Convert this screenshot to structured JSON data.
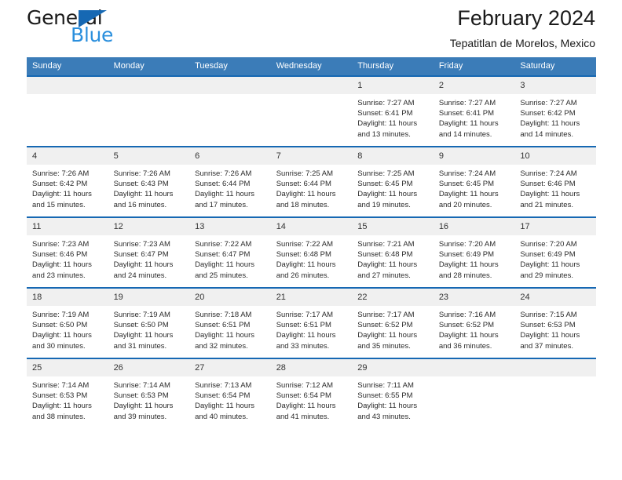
{
  "brand": {
    "name_part1": "General",
    "name_part2": "Blue",
    "triangle_color": "#1668b3",
    "blue_color": "#2a8fdd"
  },
  "header": {
    "title": "February 2024",
    "subtitle": "Tepatitlan de Morelos, Mexico"
  },
  "theme": {
    "header_bar_color": "#3b7cb8",
    "row_border_color": "#1668b3",
    "daynum_band_color": "#f0f0f0"
  },
  "calendar": {
    "weekday_headers": [
      "Sunday",
      "Monday",
      "Tuesday",
      "Wednesday",
      "Thursday",
      "Friday",
      "Saturday"
    ],
    "weeks": [
      [
        {
          "day": "",
          "sunrise": "",
          "sunset": "",
          "daylight_line1": "",
          "daylight_line2": ""
        },
        {
          "day": "",
          "sunrise": "",
          "sunset": "",
          "daylight_line1": "",
          "daylight_line2": ""
        },
        {
          "day": "",
          "sunrise": "",
          "sunset": "",
          "daylight_line1": "",
          "daylight_line2": ""
        },
        {
          "day": "",
          "sunrise": "",
          "sunset": "",
          "daylight_line1": "",
          "daylight_line2": ""
        },
        {
          "day": "1",
          "sunrise": "Sunrise: 7:27 AM",
          "sunset": "Sunset: 6:41 PM",
          "daylight_line1": "Daylight: 11 hours",
          "daylight_line2": "and 13 minutes."
        },
        {
          "day": "2",
          "sunrise": "Sunrise: 7:27 AM",
          "sunset": "Sunset: 6:41 PM",
          "daylight_line1": "Daylight: 11 hours",
          "daylight_line2": "and 14 minutes."
        },
        {
          "day": "3",
          "sunrise": "Sunrise: 7:27 AM",
          "sunset": "Sunset: 6:42 PM",
          "daylight_line1": "Daylight: 11 hours",
          "daylight_line2": "and 14 minutes."
        }
      ],
      [
        {
          "day": "4",
          "sunrise": "Sunrise: 7:26 AM",
          "sunset": "Sunset: 6:42 PM",
          "daylight_line1": "Daylight: 11 hours",
          "daylight_line2": "and 15 minutes."
        },
        {
          "day": "5",
          "sunrise": "Sunrise: 7:26 AM",
          "sunset": "Sunset: 6:43 PM",
          "daylight_line1": "Daylight: 11 hours",
          "daylight_line2": "and 16 minutes."
        },
        {
          "day": "6",
          "sunrise": "Sunrise: 7:26 AM",
          "sunset": "Sunset: 6:44 PM",
          "daylight_line1": "Daylight: 11 hours",
          "daylight_line2": "and 17 minutes."
        },
        {
          "day": "7",
          "sunrise": "Sunrise: 7:25 AM",
          "sunset": "Sunset: 6:44 PM",
          "daylight_line1": "Daylight: 11 hours",
          "daylight_line2": "and 18 minutes."
        },
        {
          "day": "8",
          "sunrise": "Sunrise: 7:25 AM",
          "sunset": "Sunset: 6:45 PM",
          "daylight_line1": "Daylight: 11 hours",
          "daylight_line2": "and 19 minutes."
        },
        {
          "day": "9",
          "sunrise": "Sunrise: 7:24 AM",
          "sunset": "Sunset: 6:45 PM",
          "daylight_line1": "Daylight: 11 hours",
          "daylight_line2": "and 20 minutes."
        },
        {
          "day": "10",
          "sunrise": "Sunrise: 7:24 AM",
          "sunset": "Sunset: 6:46 PM",
          "daylight_line1": "Daylight: 11 hours",
          "daylight_line2": "and 21 minutes."
        }
      ],
      [
        {
          "day": "11",
          "sunrise": "Sunrise: 7:23 AM",
          "sunset": "Sunset: 6:46 PM",
          "daylight_line1": "Daylight: 11 hours",
          "daylight_line2": "and 23 minutes."
        },
        {
          "day": "12",
          "sunrise": "Sunrise: 7:23 AM",
          "sunset": "Sunset: 6:47 PM",
          "daylight_line1": "Daylight: 11 hours",
          "daylight_line2": "and 24 minutes."
        },
        {
          "day": "13",
          "sunrise": "Sunrise: 7:22 AM",
          "sunset": "Sunset: 6:47 PM",
          "daylight_line1": "Daylight: 11 hours",
          "daylight_line2": "and 25 minutes."
        },
        {
          "day": "14",
          "sunrise": "Sunrise: 7:22 AM",
          "sunset": "Sunset: 6:48 PM",
          "daylight_line1": "Daylight: 11 hours",
          "daylight_line2": "and 26 minutes."
        },
        {
          "day": "15",
          "sunrise": "Sunrise: 7:21 AM",
          "sunset": "Sunset: 6:48 PM",
          "daylight_line1": "Daylight: 11 hours",
          "daylight_line2": "and 27 minutes."
        },
        {
          "day": "16",
          "sunrise": "Sunrise: 7:20 AM",
          "sunset": "Sunset: 6:49 PM",
          "daylight_line1": "Daylight: 11 hours",
          "daylight_line2": "and 28 minutes."
        },
        {
          "day": "17",
          "sunrise": "Sunrise: 7:20 AM",
          "sunset": "Sunset: 6:49 PM",
          "daylight_line1": "Daylight: 11 hours",
          "daylight_line2": "and 29 minutes."
        }
      ],
      [
        {
          "day": "18",
          "sunrise": "Sunrise: 7:19 AM",
          "sunset": "Sunset: 6:50 PM",
          "daylight_line1": "Daylight: 11 hours",
          "daylight_line2": "and 30 minutes."
        },
        {
          "day": "19",
          "sunrise": "Sunrise: 7:19 AM",
          "sunset": "Sunset: 6:50 PM",
          "daylight_line1": "Daylight: 11 hours",
          "daylight_line2": "and 31 minutes."
        },
        {
          "day": "20",
          "sunrise": "Sunrise: 7:18 AM",
          "sunset": "Sunset: 6:51 PM",
          "daylight_line1": "Daylight: 11 hours",
          "daylight_line2": "and 32 minutes."
        },
        {
          "day": "21",
          "sunrise": "Sunrise: 7:17 AM",
          "sunset": "Sunset: 6:51 PM",
          "daylight_line1": "Daylight: 11 hours",
          "daylight_line2": "and 33 minutes."
        },
        {
          "day": "22",
          "sunrise": "Sunrise: 7:17 AM",
          "sunset": "Sunset: 6:52 PM",
          "daylight_line1": "Daylight: 11 hours",
          "daylight_line2": "and 35 minutes."
        },
        {
          "day": "23",
          "sunrise": "Sunrise: 7:16 AM",
          "sunset": "Sunset: 6:52 PM",
          "daylight_line1": "Daylight: 11 hours",
          "daylight_line2": "and 36 minutes."
        },
        {
          "day": "24",
          "sunrise": "Sunrise: 7:15 AM",
          "sunset": "Sunset: 6:53 PM",
          "daylight_line1": "Daylight: 11 hours",
          "daylight_line2": "and 37 minutes."
        }
      ],
      [
        {
          "day": "25",
          "sunrise": "Sunrise: 7:14 AM",
          "sunset": "Sunset: 6:53 PM",
          "daylight_line1": "Daylight: 11 hours",
          "daylight_line2": "and 38 minutes."
        },
        {
          "day": "26",
          "sunrise": "Sunrise: 7:14 AM",
          "sunset": "Sunset: 6:53 PM",
          "daylight_line1": "Daylight: 11 hours",
          "daylight_line2": "and 39 minutes."
        },
        {
          "day": "27",
          "sunrise": "Sunrise: 7:13 AM",
          "sunset": "Sunset: 6:54 PM",
          "daylight_line1": "Daylight: 11 hours",
          "daylight_line2": "and 40 minutes."
        },
        {
          "day": "28",
          "sunrise": "Sunrise: 7:12 AM",
          "sunset": "Sunset: 6:54 PM",
          "daylight_line1": "Daylight: 11 hours",
          "daylight_line2": "and 41 minutes."
        },
        {
          "day": "29",
          "sunrise": "Sunrise: 7:11 AM",
          "sunset": "Sunset: 6:55 PM",
          "daylight_line1": "Daylight: 11 hours",
          "daylight_line2": "and 43 minutes."
        },
        {
          "day": "",
          "sunrise": "",
          "sunset": "",
          "daylight_line1": "",
          "daylight_line2": ""
        },
        {
          "day": "",
          "sunrise": "",
          "sunset": "",
          "daylight_line1": "",
          "daylight_line2": ""
        }
      ]
    ]
  }
}
